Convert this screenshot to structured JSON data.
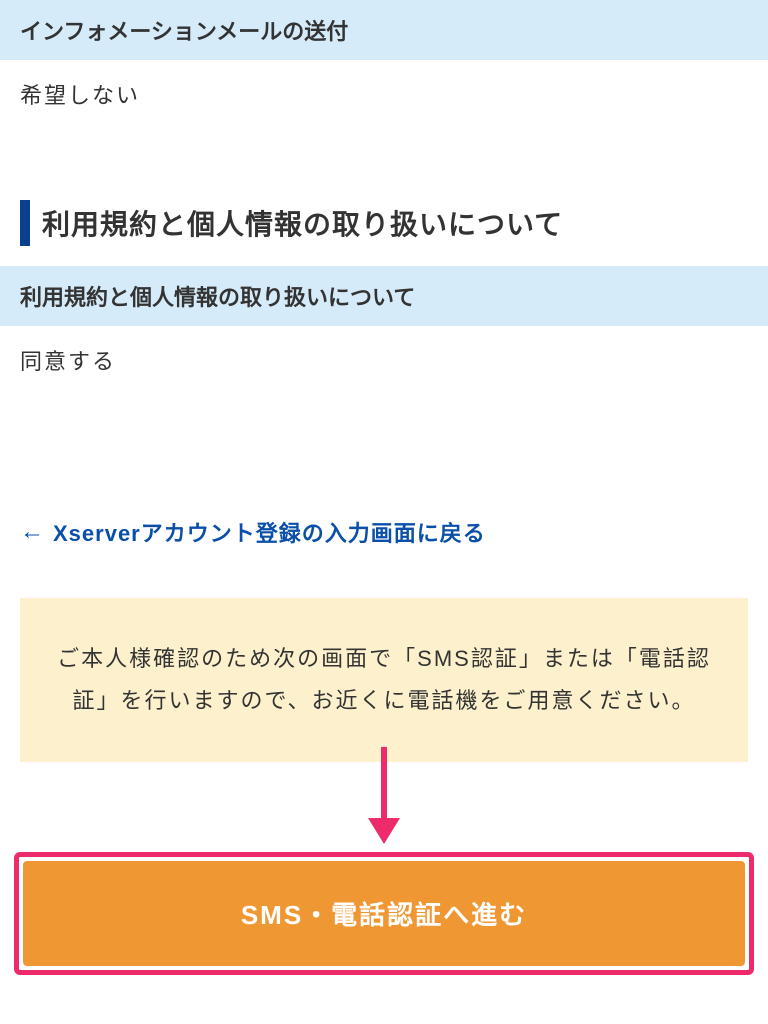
{
  "section1": {
    "header": "インフォメーションメールの送付",
    "value": "希望しない"
  },
  "section2": {
    "title": "利用規約と個人情報の取り扱いについて",
    "header": "利用規約と個人情報の取り扱いについて",
    "value": "同意する"
  },
  "backLink": {
    "text": "Xserverアカウント登録の入力画面に戻る"
  },
  "notice": {
    "text": "ご本人様確認のため次の画面で「SMS認証」または「電話認証」を行いますので、お近くに電話機をご用意ください。"
  },
  "submitButton": {
    "label": "SMS・電話認証へ進む"
  }
}
